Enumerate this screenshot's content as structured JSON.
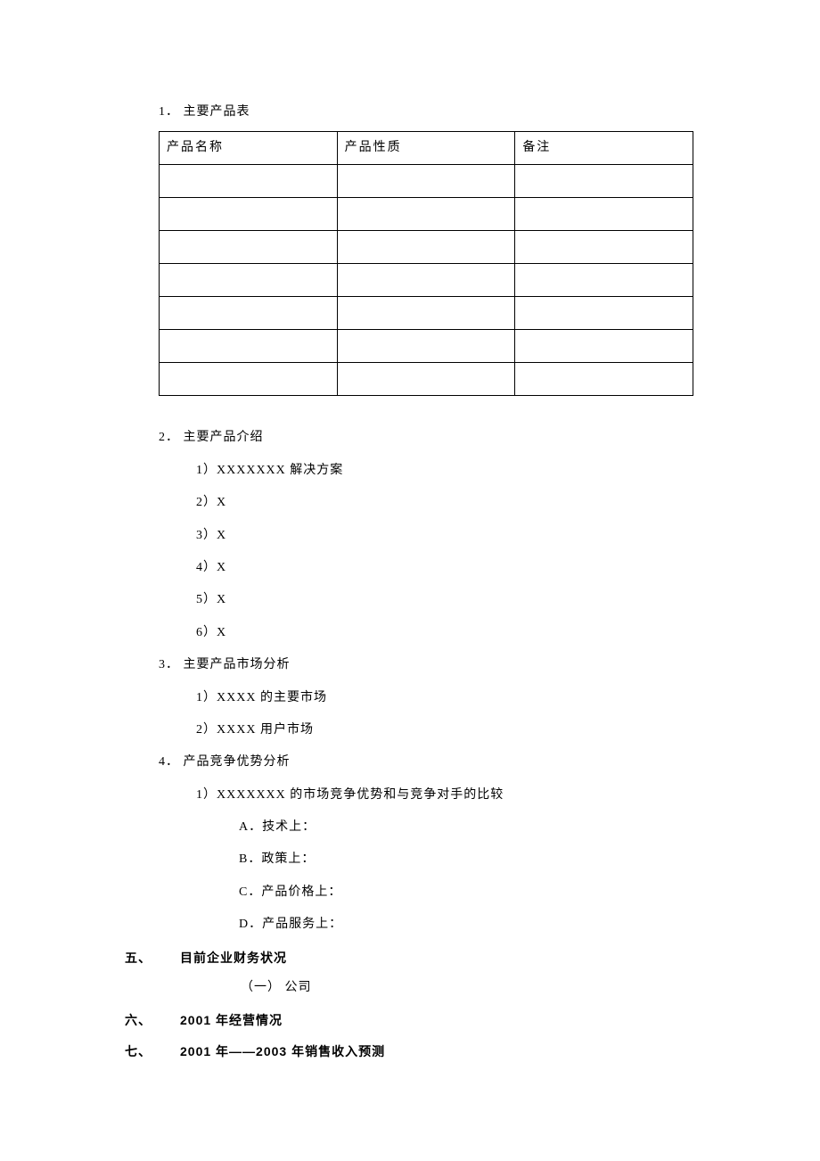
{
  "section1": {
    "num": "1．",
    "title": "主要产品表",
    "table": {
      "headers": [
        "产品名称",
        "产品性质",
        "备注"
      ],
      "empty_rows": 7
    }
  },
  "section2": {
    "num": "2．",
    "title": "主要产品介绍",
    "items": [
      "1）XXXXXXX 解决方案",
      "2）X",
      "3）X",
      "4）X",
      "5）X",
      "6）X"
    ]
  },
  "section3": {
    "num": "3．",
    "title": "主要产品市场分析",
    "items": [
      "1）XXXX 的主要市场",
      "2）XXXX 用户市场"
    ]
  },
  "section4": {
    "num": "4．",
    "title": "产品竞争优势分析",
    "item1": "1）XXXXXXX 的市场竞争优势和与竞争对手的比较",
    "subitems": [
      "A．技术上：",
      "B．政策上：",
      "C．产品价格上：",
      "D．产品服务上："
    ]
  },
  "heading5": {
    "num": "五、",
    "title": "目前企业财务状况"
  },
  "heading5_sub": "（一） 公司",
  "heading6": {
    "num": "六、",
    "title": "2001 年经营情况"
  },
  "heading7": {
    "num": "七、",
    "title": "2001 年——2003 年销售收入预测"
  }
}
